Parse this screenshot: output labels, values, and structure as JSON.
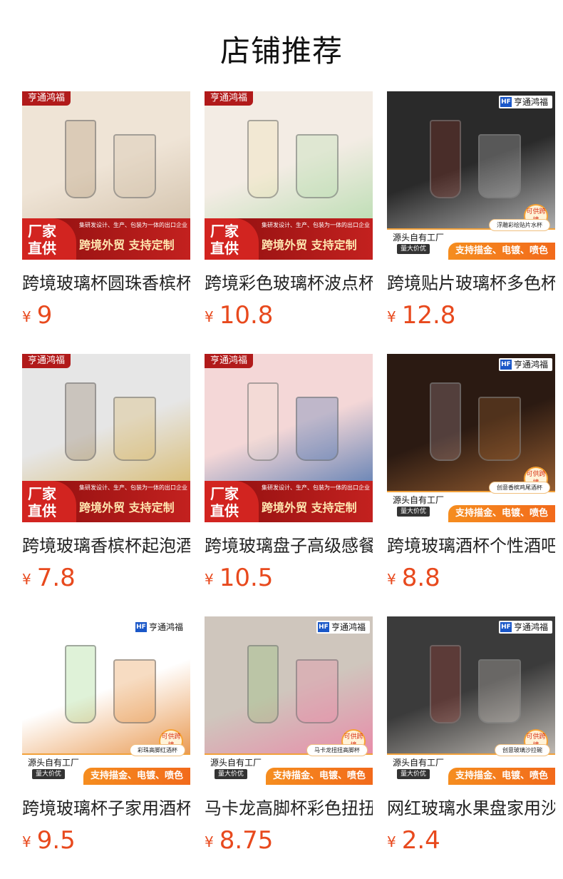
{
  "section_title": "店铺推荐",
  "currency": "¥",
  "products": [
    {
      "name": "跨境玻璃杯圆珠香槟杯",
      "price": "9",
      "image": {
        "brand": "亨通鸿福",
        "style": "red",
        "badge_line1": "厂家",
        "badge_line2": "直供",
        "subline": "集研发设计、生产、包装为一体的出口企业",
        "mainline": "跨境外贸 支持定制",
        "scene_colors": [
          "#efe4d6",
          "#c9b79e",
          "#8a6a3a"
        ]
      }
    },
    {
      "name": "跨境彩色玻璃杯波点杯",
      "price": "10.8",
      "image": {
        "brand": "亨通鸿福",
        "style": "red",
        "badge_line1": "厂家",
        "badge_line2": "直供",
        "subline": "集研发设计、生产、包装为一体的出口企业",
        "mainline": "跨境外贸 支持定制",
        "scene_colors": [
          "#f3ece4",
          "#a7d8a1",
          "#f0dc93"
        ]
      }
    },
    {
      "name": "跨境贴片玻璃杯多色杯",
      "price": "12.8",
      "image": {
        "brand": "亨通鸿福",
        "style": "orange",
        "left1": "源头自有工厂",
        "left2": "量大价优",
        "right1": "浮雕彩绘贴片水杯",
        "right2": "支持描金、电镀、喷色",
        "supply": "可供跨境",
        "scene_colors": [
          "#2a2a2a",
          "#d9d9d9",
          "#c73a2a"
        ]
      }
    },
    {
      "name": "跨境玻璃香槟杯起泡酒杯",
      "price": "7.8",
      "image": {
        "brand": "亨通鸿福",
        "style": "red",
        "badge_line1": "厂家",
        "badge_line2": "直供",
        "subline": "集研发设计、生产、包装为一体的出口企业",
        "mainline": "跨境外贸 支持定制",
        "scene_colors": [
          "#e6e6e6",
          "#d4ad4a",
          "#5a3e1a"
        ]
      }
    },
    {
      "name": "跨境玻璃盘子高级感餐盘",
      "price": "10.5",
      "image": {
        "brand": "亨通鸿福",
        "style": "red",
        "badge_line1": "厂家",
        "badge_line2": "直供",
        "subline": "集研发设计、生产、包装为一体的出口企业",
        "mainline": "跨境外贸 支持定制",
        "scene_colors": [
          "#f4d7d7",
          "#2e62a8",
          "#f0e6d0"
        ]
      }
    },
    {
      "name": "跨境玻璃酒杯个性酒吧杯",
      "price": "8.8",
      "image": {
        "brand": "亨通鸿福",
        "style": "orange",
        "left1": "源头自有工厂",
        "left2": "量大价优",
        "right1": "创意香槟鸡尾酒杯",
        "right2": "支持描金、电镀、喷色",
        "supply": "可供跨境",
        "scene_colors": [
          "#2b1a12",
          "#b8733a",
          "#f5d9e4"
        ]
      }
    },
    {
      "name": "跨境玻璃杯子家用酒杯",
      "price": "9.5",
      "image": {
        "brand": "亨通鸿福",
        "style": "orange",
        "left1": "源头自有工厂",
        "left2": "量大价优",
        "right1": "彩珠高脚红酒杯",
        "right2": "支持描金、电镀、喷色",
        "supply": "可供跨境",
        "scene_colors": [
          "#ffffff",
          "#e27a1c",
          "#5fbf3a"
        ]
      }
    },
    {
      "name": "马卡龙高脚杯彩色扭扭杯",
      "price": "8.75",
      "image": {
        "brand": "亨通鸿福",
        "style": "orange",
        "left1": "源头自有工厂",
        "left2": "量大价优",
        "right1": "马卡龙扭扭高脚杯",
        "right2": "支持描金、电镀、喷色",
        "supply": "可供跨境",
        "scene_colors": [
          "#cfc6bd",
          "#f07aa3",
          "#6fc44a"
        ]
      }
    },
    {
      "name": "网红玻璃水果盘家用沙拉碗",
      "price": "2.4",
      "image": {
        "brand": "亨通鸿福",
        "style": "orange",
        "left1": "源头自有工厂",
        "left2": "量大价优",
        "right1": "创意玻璃沙拉碗",
        "right2": "支持描金、电镀、喷色",
        "supply": "可供跨境",
        "scene_colors": [
          "#3b3b3b",
          "#e8e2da",
          "#e23a2c"
        ]
      }
    }
  ]
}
